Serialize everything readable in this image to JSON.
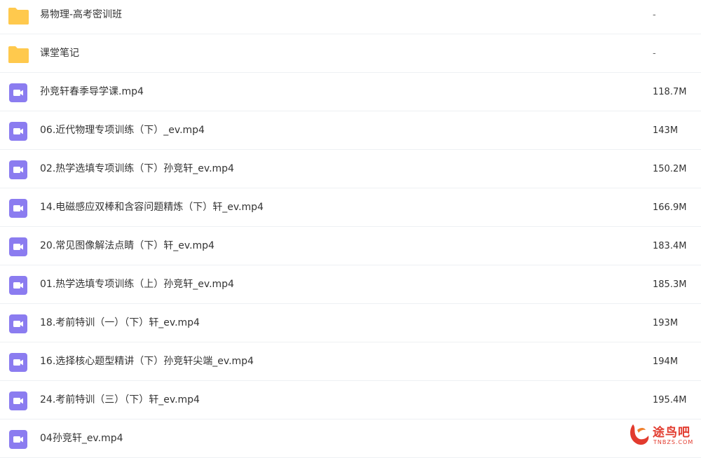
{
  "items": [
    {
      "name": "易物理-高考密训班",
      "size": "-",
      "type": "folder"
    },
    {
      "name": "课堂笔记",
      "size": "-",
      "type": "folder"
    },
    {
      "name": "孙竞轩春季导学课.mp4",
      "size": "118.7M",
      "type": "video"
    },
    {
      "name": "06.近代物理专项训练（下）_ev.mp4",
      "size": "143M",
      "type": "video"
    },
    {
      "name": "02.热学选填专项训练（下）孙竞轩_ev.mp4",
      "size": "150.2M",
      "type": "video"
    },
    {
      "name": "14.电磁感应双棒和含容问题精炼（下）轩_ev.mp4",
      "size": "166.9M",
      "type": "video"
    },
    {
      "name": "20.常见图像解法点睛（下）轩_ev.mp4",
      "size": "183.4M",
      "type": "video"
    },
    {
      "name": "01.热学选填专项训练（上）孙竞轩_ev.mp4",
      "size": "185.3M",
      "type": "video"
    },
    {
      "name": "18.考前特训（一）（下）轩_ev.mp4",
      "size": "193M",
      "type": "video"
    },
    {
      "name": "16.选择核心题型精讲（下）孙竞轩尖端_ev.mp4",
      "size": "194M",
      "type": "video"
    },
    {
      "name": "24.考前特训（三）（下）轩_ev.mp4",
      "size": "195.4M",
      "type": "video"
    },
    {
      "name": "04孙竞轩_ev.mp4",
      "size": "",
      "type": "video"
    }
  ],
  "icons": {
    "folder": "folder-icon",
    "video": "video-file-icon"
  },
  "colors": {
    "folder": "#ffc94d",
    "video": "#8b7cf0",
    "watermark": "#e23b2e"
  },
  "watermark": {
    "text": "途鸟吧",
    "sub": "TNBZS.COM"
  }
}
